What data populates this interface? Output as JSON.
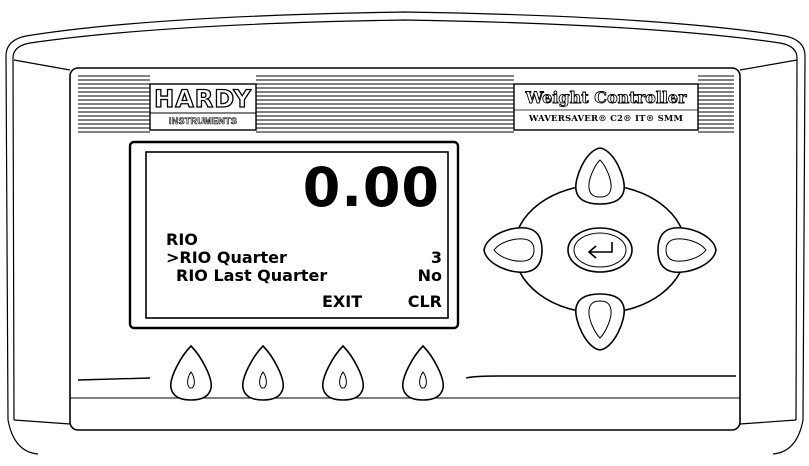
{
  "brand": {
    "logo": "HARDY",
    "logo_subtitle": "INSTRUMENTS"
  },
  "product": {
    "title": "Weight Controller",
    "models": "WAVERSAVER® C2® IT® SMM"
  },
  "display": {
    "weight": "0.00",
    "menu_title": "RIO",
    "rows": [
      {
        "label": ">RIO Quarter",
        "value": "3"
      },
      {
        "label": "RIO Last Quarter",
        "value": "No"
      }
    ],
    "softkeys": {
      "exit": "EXIT",
      "clr": "CLR"
    }
  },
  "icons": {
    "nav_up": "chevron-up-icon",
    "nav_down": "chevron-down-icon",
    "nav_left": "chevron-left-icon",
    "nav_right": "chevron-right-icon",
    "enter": "enter-return-icon",
    "softkey": "teardrop-key-icon"
  },
  "colors": {
    "body": "#ffffff",
    "outline": "#000000"
  }
}
